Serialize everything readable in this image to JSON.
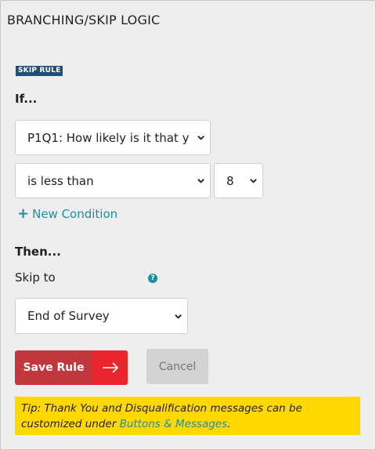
{
  "panel": {
    "title": "BRANCHING/SKIP LOGIC",
    "badge": "SKIP RULE"
  },
  "if_section": {
    "label": "If...",
    "question_select": {
      "value": "P1Q1: How likely is it that y"
    },
    "operator_select": {
      "value": "is less than"
    },
    "value_select": {
      "value": "8"
    },
    "new_condition_label": "New Condition"
  },
  "then_section": {
    "label": "Then...",
    "skip_label": "Skip to",
    "help_icon": "?",
    "skip_target_select": {
      "value": "End of Survey"
    }
  },
  "actions": {
    "save_label": "Save Rule",
    "cancel_label": "Cancel"
  },
  "tip": {
    "text": "Tip: Thank You and Disqualification messages can be customized under ",
    "link": "Buttons & Messages",
    "suffix": "."
  },
  "colors": {
    "badge_bg": "#1e4e79",
    "save_bg": "#c1373c",
    "save_arrow_bg": "#e8262c",
    "link": "#1f8fa4",
    "tip_bg": "#ffd800"
  }
}
